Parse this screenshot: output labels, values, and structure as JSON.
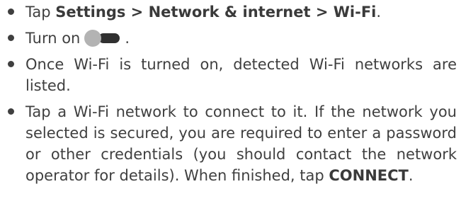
{
  "steps": [
    {
      "prefix": "Tap ",
      "bold": "Settings > Network & internet > Wi-Fi",
      "suffix": "."
    },
    {
      "prefix": "Turn on",
      "icon": "toggle-switch-icon",
      "suffix": "."
    },
    {
      "text": "Once Wi-Fi is turned on, detected Wi-Fi networks are listed."
    },
    {
      "text": "Tap a Wi-Fi network to connect to it. If the network you selected is secured, you are required to enter a password or other credentials (you should contact the network operator for details). When finished, tap ",
      "bold": "CONNECT",
      "suffix": "."
    }
  ],
  "colors": {
    "text": "#3f3f3f",
    "toggle_knob": "#b3b3b3",
    "toggle_track": "#303030"
  }
}
